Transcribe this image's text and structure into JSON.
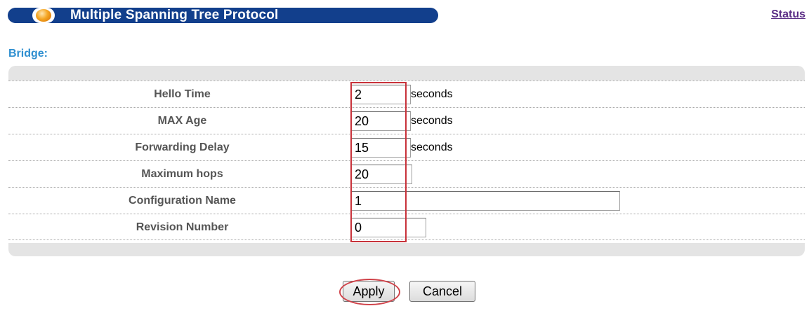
{
  "header": {
    "title": "Multiple Spanning Tree Protocol",
    "status_link": "Status"
  },
  "section": {
    "title": "Bridge:"
  },
  "fields": [
    {
      "label": "Hello Time",
      "value": "2",
      "unit": "seconds"
    },
    {
      "label": "MAX Age",
      "value": "20",
      "unit": "seconds"
    },
    {
      "label": "Forwarding Delay",
      "value": "15",
      "unit": "seconds"
    },
    {
      "label": "Maximum hops",
      "value": "20",
      "unit": ""
    },
    {
      "label": "Configuration Name",
      "value": "1",
      "unit": ""
    },
    {
      "label": "Revision Number",
      "value": "0",
      "unit": ""
    }
  ],
  "buttons": {
    "apply": "Apply",
    "cancel": "Cancel"
  },
  "colors": {
    "title_bar": "#123f8c",
    "section_title": "#2f8fd0",
    "highlight": "#c8323a",
    "status_link": "#5b2e86"
  }
}
